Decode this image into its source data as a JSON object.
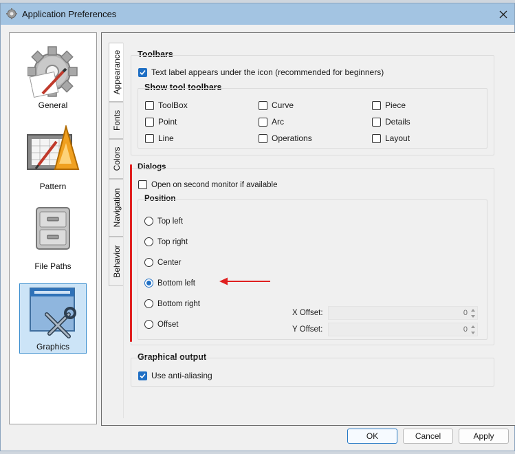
{
  "window": {
    "title": "Application Preferences"
  },
  "sidebar": {
    "items": [
      {
        "label": "General",
        "icon": "gear-icon",
        "selected": false
      },
      {
        "label": "Pattern",
        "icon": "pattern-drafting-icon",
        "selected": false
      },
      {
        "label": "File Paths",
        "icon": "file-cabinet-icon",
        "selected": false
      },
      {
        "label": "Graphics",
        "icon": "graphics-tools-icon",
        "selected": true
      }
    ]
  },
  "tabs": [
    {
      "label": "Appearance",
      "active": true
    },
    {
      "label": "Fonts",
      "active": false
    },
    {
      "label": "Colors",
      "active": false
    },
    {
      "label": "Navigation",
      "active": false
    },
    {
      "label": "Behavior",
      "active": false
    }
  ],
  "toolbars": {
    "title": "Toolbars",
    "text_label_option": {
      "label": "Text label appears under the icon (recommended for beginners)",
      "checked": true
    },
    "show_tool_toolbars": {
      "title": "Show tool toolbars",
      "items": [
        {
          "label": "ToolBox",
          "checked": false
        },
        {
          "label": "Curve",
          "checked": false
        },
        {
          "label": "Piece",
          "checked": false
        },
        {
          "label": "Point",
          "checked": false
        },
        {
          "label": "Arc",
          "checked": false
        },
        {
          "label": "Details",
          "checked": false
        },
        {
          "label": "Line",
          "checked": false
        },
        {
          "label": "Operations",
          "checked": false
        },
        {
          "label": "Layout",
          "checked": false
        }
      ]
    }
  },
  "dialogs": {
    "title": "Dialogs",
    "second_monitor": {
      "label": "Open on second monitor if available",
      "checked": false
    },
    "position": {
      "title": "Position",
      "options": [
        {
          "label": "Top left",
          "checked": false
        },
        {
          "label": "Top right",
          "checked": false
        },
        {
          "label": "Center",
          "checked": false
        },
        {
          "label": "Bottom left",
          "checked": true
        },
        {
          "label": "Bottom right",
          "checked": false
        },
        {
          "label": "Offset",
          "checked": false
        }
      ],
      "x_offset": {
        "label": "X Offset:",
        "value": "0"
      },
      "y_offset": {
        "label": "Y Offset:",
        "value": "0"
      }
    }
  },
  "graphical_output": {
    "title": "Graphical output",
    "anti_aliasing": {
      "label": "Use anti-aliasing",
      "checked": true
    }
  },
  "buttons": {
    "ok": "OK",
    "cancel": "Cancel",
    "apply": "Apply"
  },
  "colors": {
    "accent": "#1f6fc4",
    "annotation": "#e02020",
    "titlebar": "#a3c4e2"
  }
}
